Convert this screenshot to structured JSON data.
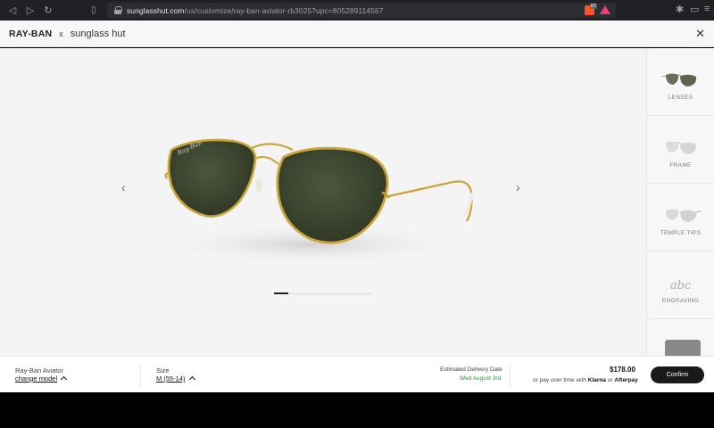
{
  "browser": {
    "url_host": "sunglasshut.com",
    "url_path": "/us/customize/ray-ban-aviator-rb3025?upc=805289114567",
    "brave_badge": "67"
  },
  "header": {
    "brand_primary": "RAY-BAN",
    "brand_separator": "x",
    "brand_secondary": "sunglass hut"
  },
  "viewer": {
    "image_index": 1,
    "image_count": 7
  },
  "sidebar": {
    "items": [
      {
        "label": "LENSES",
        "icon": "lenses-icon"
      },
      {
        "label": "FRAME",
        "icon": "frame-icon"
      },
      {
        "label": "TEMPLE TIPS",
        "icon": "temple-tips-icon"
      },
      {
        "label": "ENGRAVING",
        "icon": "engraving-icon",
        "glyph": "abc"
      }
    ]
  },
  "bottom": {
    "model_label": "Ray-Ban Aviator",
    "change_model": "change model",
    "size_label": "Size",
    "size_value": "M (55-14)",
    "delivery_label": "Estimated Delivery Date",
    "delivery_date": "Wed August 3rd",
    "price": "$178.00",
    "pay_prefix": "or pay over time with",
    "pay_klarna": "Klarna",
    "pay_or": "or",
    "pay_afterpay": "Afterpay",
    "confirm_label": "Confirm"
  },
  "colors": {
    "accent_green": "#2e8b3e",
    "lens": "#3f4a33",
    "frame_gold": "#c9a43a",
    "confirm_bg": "#1a1a1a"
  }
}
